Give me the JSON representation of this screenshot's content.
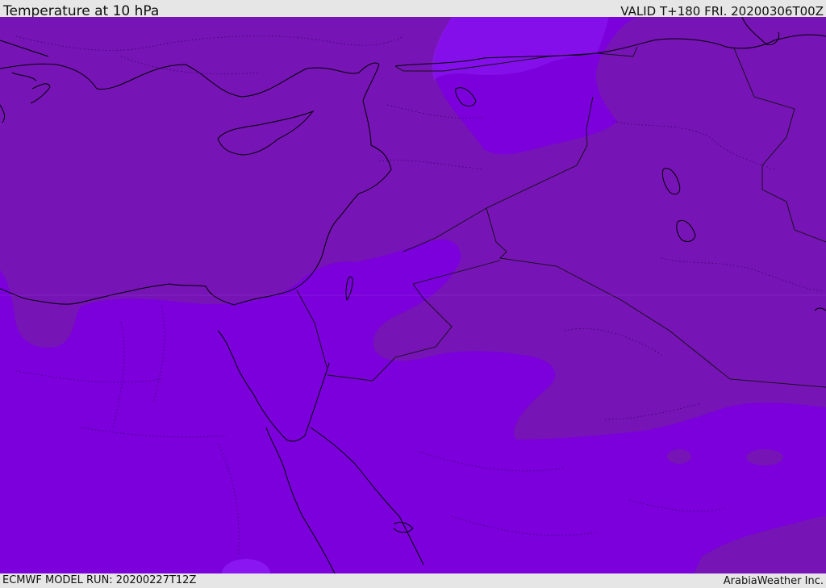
{
  "header": {
    "title": "Temperature at 10 hPa",
    "valid": "VALID T+180 FRI. 20200306T00Z"
  },
  "footer": {
    "model_run": "ECMWF MODEL RUN: 20200227T12Z",
    "credit": "ArabiaWeather Inc."
  },
  "map": {
    "parameter": "Temperature",
    "level": "10 hPa",
    "fill_colors": {
      "dark_band": "#7614b5",
      "main_band": "#7b00dc",
      "light_band": "#8a17f2",
      "coastline": "#000000",
      "borders": "#1a1a1a"
    }
  }
}
